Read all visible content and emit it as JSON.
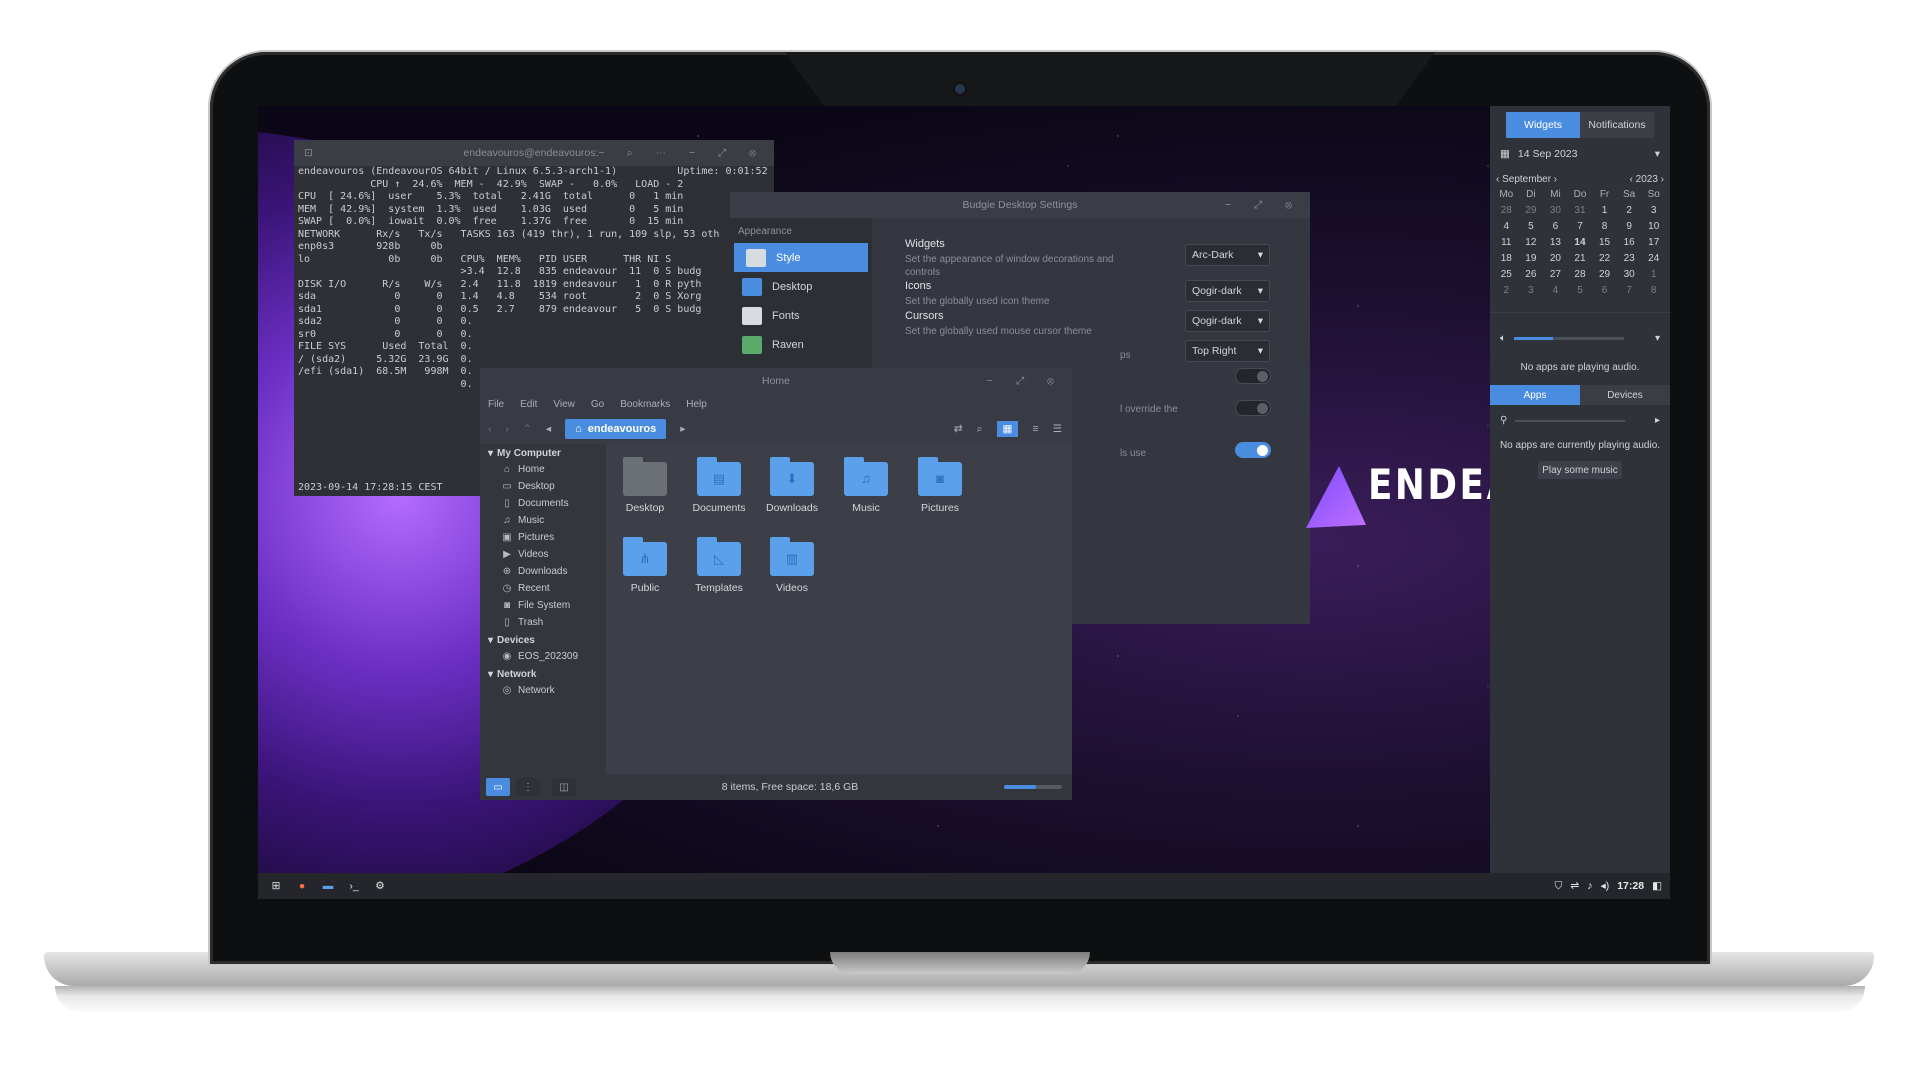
{
  "terminal": {
    "title": "endeavouros@endeavouros:~",
    "lines": [
      "endeavouros (EndeavourOS 64bit / Linux 6.5.3-arch1-1)          Uptime: 0:01:52",
      "",
      "            CPU ↑  24.6%  MEM -  42.9%  SWAP -   0.0%   LOAD - 2",
      "CPU  [ 24.6%]  user    5.3%  total   2.41G  total      0   1 min",
      "MEM  [ 42.9%]  system  1.3%  used    1.03G  used       0   5 min",
      "SWAP [  0.0%]  iowait  0.0%  free    1.37G  free       0  15 min",
      "",
      "NETWORK      Rx/s   Tx/s   TASKS 163 (419 thr), 1 run, 109 slp, 53 oth",
      "enp0s3       928b     0b",
      "lo             0b     0b   CPU%  MEM%   PID USER      THR NI S",
      "                           >3.4  12.8   835 endeavour  11  0 S budg",
      "DISK I/O      R/s    W/s   2.4   11.8  1819 endeavour   1  0 R pyth",
      "sda             0      0   1.4   4.8    534 root        2  0 S Xorg",
      "sda1            0      0   0.5   2.7    879 endeavour   5  0 S budg",
      "sda2            0      0   0.",
      "sr0             0      0   0.",
      "",
      "FILE SYS      Used  Total  0.",
      "/ (sda2)     5.32G  23.9G  0.",
      "/efi (sda1)  68.5M   998M  0.",
      "                           0."
    ],
    "timestamp": "2023-09-14 17:28:15 CEST"
  },
  "settings": {
    "title": "Budgie Desktop Settings",
    "section": "Appearance",
    "nav": [
      "Style",
      "Desktop",
      "Fonts",
      "Raven"
    ],
    "rows": [
      {
        "heading": "Widgets",
        "desc": "Set the appearance of window decorations and controls",
        "value": "Arc-Dark"
      },
      {
        "heading": "Icons",
        "desc": "Set the globally used icon theme",
        "value": "Qogir-dark"
      },
      {
        "heading": "Cursors",
        "desc": "Set the globally used mouse cursor theme",
        "value": "Qogir-dark"
      }
    ],
    "position_value": "Top Right",
    "partial_1": "ps",
    "partial_2": "l override the",
    "partial_3": "ls use"
  },
  "files": {
    "title": "Home",
    "menu": [
      "File",
      "Edit",
      "View",
      "Go",
      "Bookmarks",
      "Help"
    ],
    "path": "endeavouros",
    "sidebar": {
      "my_computer": "My Computer",
      "places": [
        "Home",
        "Desktop",
        "Documents",
        "Music",
        "Pictures",
        "Videos",
        "Downloads",
        "Recent",
        "File System",
        "Trash"
      ],
      "devices": "Devices",
      "device_items": [
        "EOS_202309"
      ],
      "network": "Network",
      "network_items": [
        "Network"
      ]
    },
    "folders": [
      "Desktop",
      "Documents",
      "Downloads",
      "Music",
      "Pictures",
      "Public",
      "Templates",
      "Videos"
    ],
    "status": "8 items, Free space: 18,6 GB",
    "zoom_level": 0.55
  },
  "logo_text": "ENDEAVO",
  "raven": {
    "tabs": [
      "Widgets",
      "Notifications"
    ],
    "date": "14 Sep 2023",
    "month": "September",
    "year": "2023",
    "weekdays": [
      "Mo",
      "Di",
      "Mi",
      "Do",
      "Fr",
      "Sa",
      "So"
    ],
    "days": [
      "28",
      "29",
      "30",
      "31",
      "1",
      "2",
      "3",
      "4",
      "5",
      "6",
      "7",
      "8",
      "9",
      "10",
      "11",
      "12",
      "13",
      "14",
      "15",
      "16",
      "17",
      "18",
      "19",
      "20",
      "21",
      "22",
      "23",
      "24",
      "25",
      "26",
      "27",
      "28",
      "29",
      "30",
      "1",
      "2",
      "3",
      "4",
      "5",
      "6",
      "7",
      "8"
    ],
    "volume_level": 0.35,
    "no_audio": "No apps are playing audio.",
    "subtabs": [
      "Apps",
      "Devices"
    ],
    "no_audio2": "No apps are currently playing audio.",
    "play_button": "Play some music"
  },
  "panel": {
    "clock": "17:28"
  }
}
